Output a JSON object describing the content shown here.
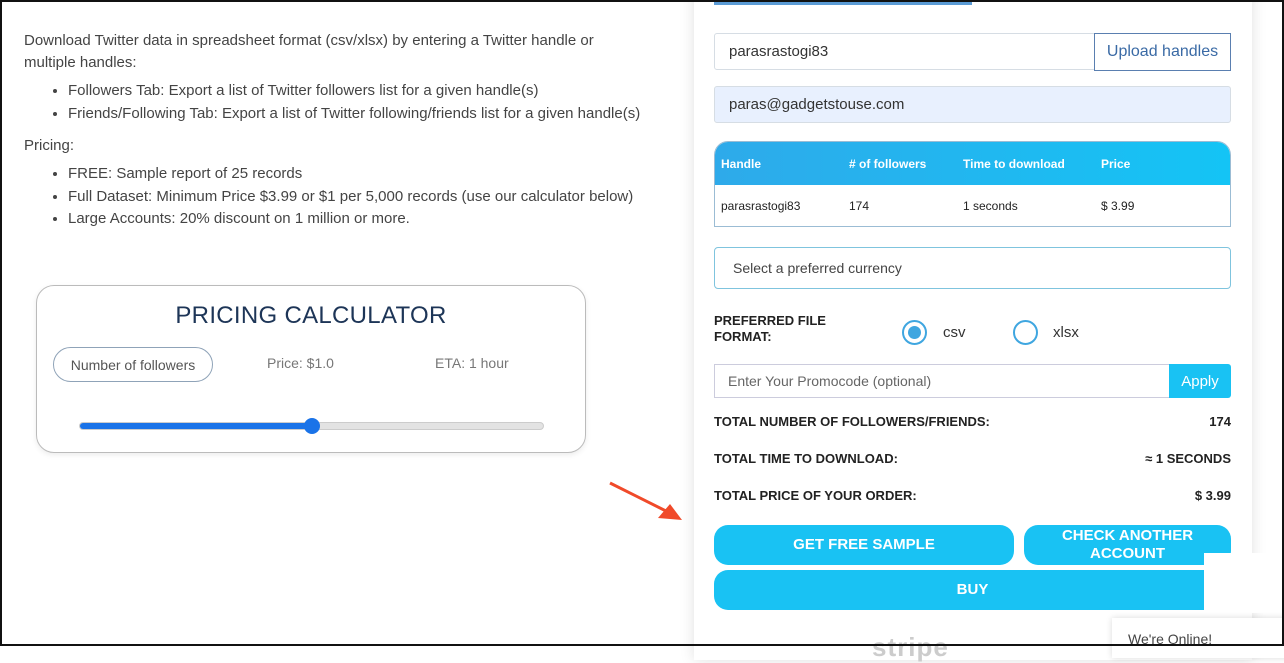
{
  "intro": "Download Twitter data in spreadsheet format (csv/xlsx) by entering a Twitter handle or multiple handles:",
  "features": [
    "Followers Tab: Export a list of Twitter followers list for a given handle(s)",
    "Friends/Following Tab: Export a list of Twitter following/friends list for a given handle(s)"
  ],
  "pricing_label": "Pricing:",
  "pricing": [
    "FREE: Sample report of 25 records",
    "Full Dataset: Minimum Price $3.99 or $1 per 5,000 records (use our calculator below)",
    "Large Accounts: 20% discount on 1 million or more."
  ],
  "calculator": {
    "title": "PRICING CALCULATOR",
    "followers_button": "Number of followers",
    "price": "Price: $1.0",
    "eta": "ETA: 1 hour",
    "slider_percent": 50
  },
  "form": {
    "handle_value": "parasrastogi83",
    "upload_label": "Upload handles",
    "email_value": "paras@gadgetstouse.com",
    "table": {
      "headers": [
        "Handle",
        "# of followers",
        "Time to download",
        "Price"
      ],
      "rows": [
        [
          "parasrastogi83",
          "174",
          "1 seconds",
          "$ 3.99"
        ]
      ]
    },
    "currency_placeholder": "Select a preferred currency",
    "format_label": "PREFERRED FILE FORMAT:",
    "formats": [
      "csv",
      "xlsx"
    ],
    "selected_format": "csv",
    "promo_placeholder": "Enter Your Promocode (optional)",
    "apply_label": "Apply",
    "totals": [
      {
        "label": "TOTAL NUMBER OF FOLLOWERS/FRIENDS:",
        "value": "174"
      },
      {
        "label": "TOTAL TIME TO DOWNLOAD:",
        "value": "≈ 1 SECONDS"
      },
      {
        "label": "TOTAL PRICE OF YOUR ORDER:",
        "value": "$ 3.99"
      }
    ],
    "sample_button": "GET FREE SAMPLE",
    "check_button": "CHECK ANOTHER ACCOUNT",
    "buy_button": "BUY"
  },
  "stripe_logo": "stripe",
  "chat": "We're Online!",
  "colors": {
    "accent": "#19c2f3",
    "slider": "#1a73e8",
    "arrow": "#f04a2a"
  }
}
